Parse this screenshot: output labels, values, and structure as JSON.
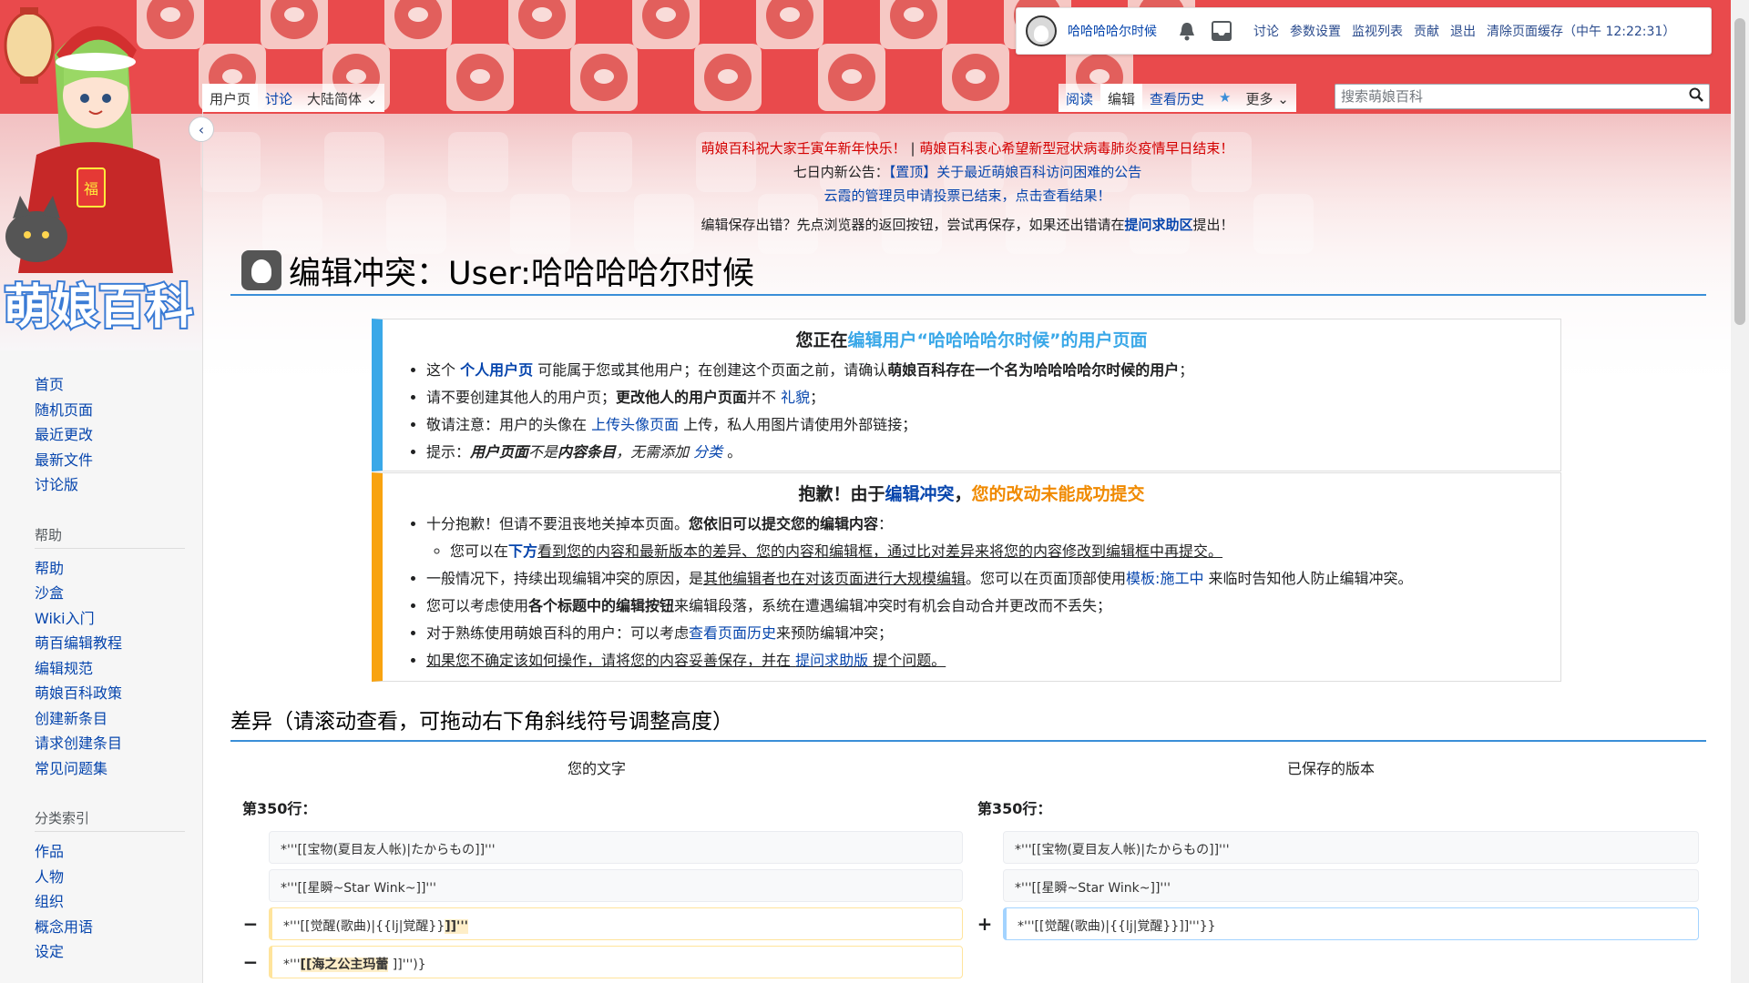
{
  "logo": {
    "text": "萌娘百科"
  },
  "user_tools": {
    "username": "哈哈哈哈尔时候",
    "links": [
      "讨论",
      "参数设置",
      "监视列表",
      "贡献",
      "退出",
      "清除页面缓存（中午 12:22:31）"
    ]
  },
  "tabs_left": [
    "用户页",
    "讨论",
    "大陆简体"
  ],
  "tabs_right": [
    "阅读",
    "编辑",
    "查看历史",
    "更多"
  ],
  "search": {
    "placeholder": "搜索萌娘百科"
  },
  "sidebar": {
    "main": [
      "首页",
      "随机页面",
      "最近更改",
      "最新文件",
      "讨论版"
    ],
    "help_head": "帮助",
    "help": [
      "帮助",
      "沙盒",
      "Wiki入门",
      "萌百编辑教程",
      "编辑规范",
      "萌娘百科政策",
      "创建新条目",
      "请求创建条目",
      "常见问题集"
    ],
    "cat_head": "分类索引",
    "cat": [
      "作品",
      "人物",
      "组织",
      "概念用语",
      "设定"
    ]
  },
  "sitenotice": {
    "line1a": "萌娘百科祝大家壬寅年新年快乐！",
    "sep": "|",
    "line1b": "萌娘百科衷心希望新型冠状病毒肺炎疫情早日结束！",
    "line2a": "七日内新公告：",
    "line2b": "【置顶】关于最近萌娘百科访问困难的公告",
    "line3": "云霞的管理员申请投票已结束，点击查看结果！",
    "line4a": "编辑保存出错？先点浏览器的返回按钮，尝试再保存，如果还出错请在",
    "line4b": "提问求助区",
    "line4c": "提出！"
  },
  "page_title": "编辑冲突：User:哈哈哈哈尔时候",
  "notice_user": {
    "heading_a": "您正在",
    "heading_b": "编辑用户“哈哈哈哈尔时候”的用户页面",
    "item1_a": "这个",
    "item1_b": "个人用户页",
    "item1_c": "可能属于您或其他用户；在创建这个页面之前，请确认",
    "item1_d": "萌娘百科存在一个名为哈哈哈哈尔时候的用户",
    "item1_e": "；",
    "item2_a": "请不要创建其他人的用户页；",
    "item2_b": "更改他人的用户页面",
    "item2_c": "并不",
    "item2_d": "礼貌",
    "item2_e": "；",
    "item3_a": "敬请注意：用户的头像在",
    "item3_b": "上传头像页面",
    "item3_c": "上传，私人用图片请使用外部链接；",
    "item4_a": "提示：",
    "item4_b": "用户页面",
    "item4_c": "不是",
    "item4_d": "内容条目",
    "item4_e": "，无需添加",
    "item4_f": "分类",
    "item4_g": "。"
  },
  "notice_conflict": {
    "heading_a": "抱歉！由于",
    "heading_b": "编辑冲突",
    "heading_c": "，",
    "heading_d": "您的改动未能成功提交",
    "item1_a": "十分抱歉！但请不要沮丧地关掉本页面。",
    "item1_b": "您依旧可以提交您的编辑内容",
    "item1_c": "：",
    "sub1_a": "您可以在",
    "sub1_b": "下方",
    "sub1_c": "看到您的内容和最新版本的差异、您的内容和编辑框，通过比对差异来将您的内容修改到编辑框中再提交。",
    "item2_a": "一般情况下，持续出现编辑冲突的原因，是",
    "item2_b": "其他编辑者也在对该页面进行大规模编辑",
    "item2_c": "。您可以在页面顶部使用",
    "item2_d": "模板:施工中",
    "item2_e": "来临时告知他人防止编辑冲突。",
    "item3_a": "您可以考虑使用",
    "item3_b": "各个标题中的编辑按钮",
    "item3_c": "来编辑段落，系统在遭遇编辑冲突时有机会自动合并更改而不丢失；",
    "item4_a": "对于熟练使用萌娘百科的用户：可以考虑",
    "item4_b": "查看页面历史",
    "item4_c": "来预防编辑冲突；",
    "item5_a": "如果您不确定该如何操作，请将您的内容妥善保存，并在",
    "item5_b": "提问求助版",
    "item5_c": "提个问题。"
  },
  "diff": {
    "heading": "差异（请滚动查看，可拖动右下角斜线符号调整高度）",
    "left_head": "您的文字",
    "right_head": "已保存的版本",
    "left_lineno": "第350行：",
    "right_lineno": "第350行：",
    "left_lines": [
      "*'''[[宝物(夏目友人帐)|たからもの]]'''",
      "*'''[[星瞬~Star Wink~]]'''"
    ],
    "right_lines": [
      "*'''[[宝物(夏目友人帐)|たからもの]]'''",
      "*'''[[星瞬~Star Wink~]]'''"
    ],
    "del1_pre": "*'''[[觉醒(歌曲)|{{lj|覚醒}}",
    "del1_hl": "]]'''",
    "del2_pre": "*'''",
    "del2_hl": "[[海之公主玛蕾",
    "del2_post": " ]]''')}",
    "add1": "*'''[[觉醒(歌曲)|{{lj|覚醒}}]]'''}}",
    "minus": "−",
    "plus": "+"
  }
}
